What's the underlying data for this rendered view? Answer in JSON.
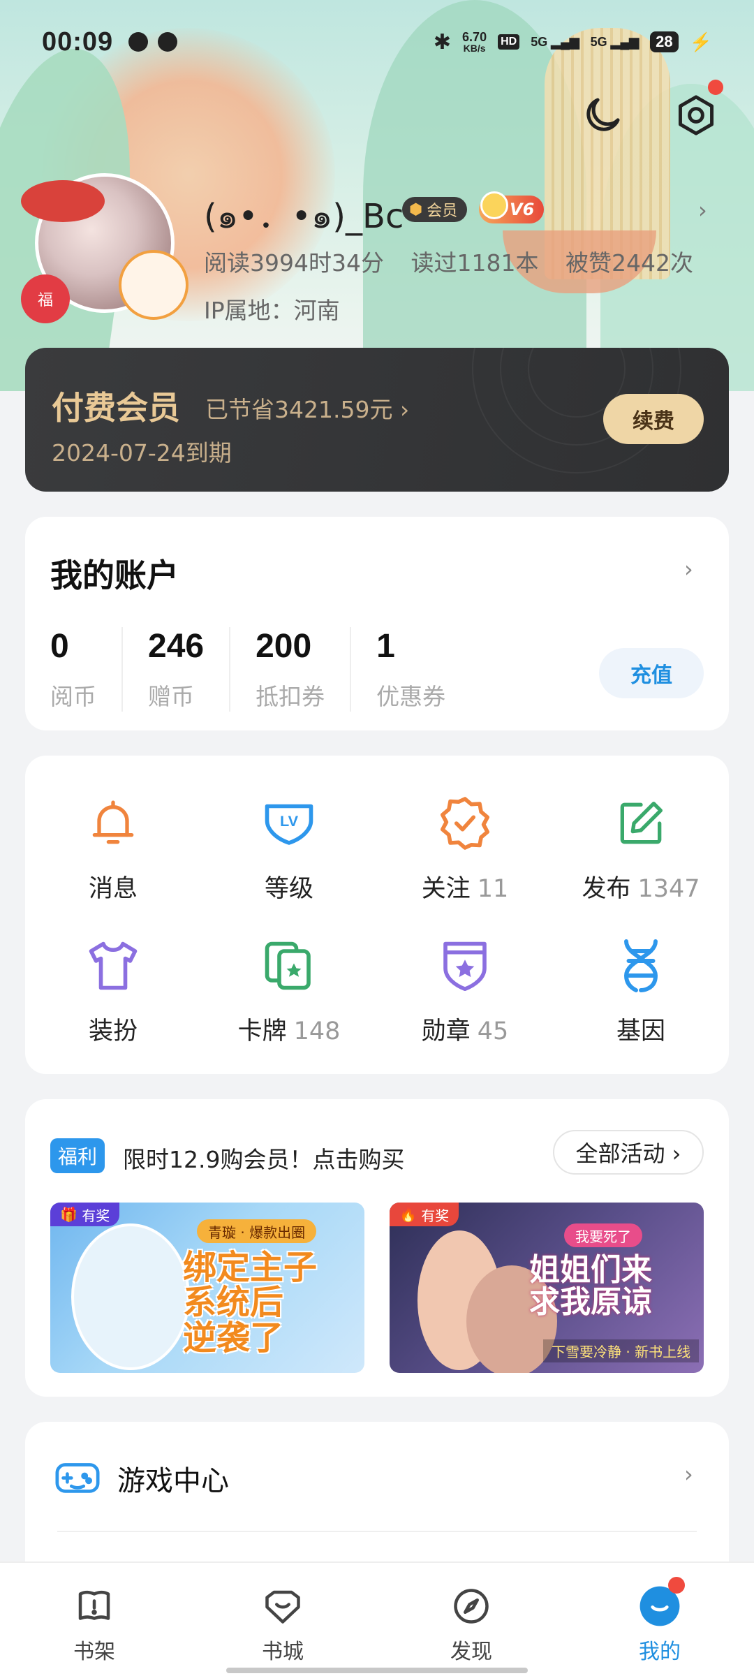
{
  "status_bar": {
    "time": "00:09",
    "net_speed_value": "6.70",
    "net_speed_unit": "KB/s",
    "hd_label": "HD",
    "signal1": "5G",
    "signal2": "5G",
    "battery": "28"
  },
  "profile": {
    "username": "(๑•．•๑)_Bc",
    "vip_badge": "会员",
    "level_badge": "V6",
    "stats": {
      "reading_time": "阅读3994时34分",
      "books_read": "读过1181本",
      "likes": "被赞2442次"
    },
    "ip_location": "IP属地：河南",
    "avatar_deco_text": "福"
  },
  "membership": {
    "title": "付费会员",
    "saved": "已节省3421.59元 ›",
    "expiry": "2024-07-24到期",
    "renew_label": "续费"
  },
  "account": {
    "title": "我的账户",
    "items": [
      {
        "value": "0",
        "label": "阅币"
      },
      {
        "value": "246",
        "label": "赠币"
      },
      {
        "value": "200",
        "label": "抵扣券"
      },
      {
        "value": "1",
        "label": "优惠券"
      }
    ],
    "recharge_label": "充值"
  },
  "grid": {
    "row1": [
      {
        "label": "消息",
        "count": "",
        "icon": "bell-icon",
        "color": "#f0843d"
      },
      {
        "label": "等级",
        "count": "",
        "icon": "level-badge-icon",
        "color": "#2d97ec"
      },
      {
        "label": "关注",
        "count": "11",
        "icon": "follow-badge-icon",
        "color": "#f0843d"
      },
      {
        "label": "发布",
        "count": "1347",
        "icon": "edit-icon",
        "color": "#3aa96b"
      }
    ],
    "row2": [
      {
        "label": "装扮",
        "count": "",
        "icon": "shirt-icon",
        "color": "#8b6fe0"
      },
      {
        "label": "卡牌",
        "count": "148",
        "icon": "cards-icon",
        "color": "#3aa96b"
      },
      {
        "label": "勋章",
        "count": "45",
        "icon": "medal-icon",
        "color": "#8b6fe0"
      },
      {
        "label": "基因",
        "count": "",
        "icon": "dna-icon",
        "color": "#2d97ec"
      }
    ]
  },
  "promo": {
    "tag": "福利",
    "text": "限时12.9购会员！点击购买",
    "all_label": "全部活动 ›",
    "banners": [
      {
        "tag": "有奖",
        "sub": "青璇 · 爆款出圈",
        "headline_line1": "绑定主子",
        "headline_line2": "系统后",
        "headline_line3": "逆袭了"
      },
      {
        "tag": "有奖",
        "sub": "我要死了",
        "headline_line1": "姐姐们来",
        "headline_line2": "求我原谅",
        "foot": "下雪要冷静 · 新书上线"
      }
    ]
  },
  "game_center": {
    "label": "游戏中心"
  },
  "tabbar": {
    "tabs": [
      {
        "label": "书架",
        "icon": "bookshelf-icon"
      },
      {
        "label": "书城",
        "icon": "bookstore-icon"
      },
      {
        "label": "发现",
        "icon": "compass-icon"
      },
      {
        "label": "我的",
        "icon": "profile-icon"
      }
    ],
    "active_index": 3,
    "accent_color": "#1f8fe0"
  }
}
